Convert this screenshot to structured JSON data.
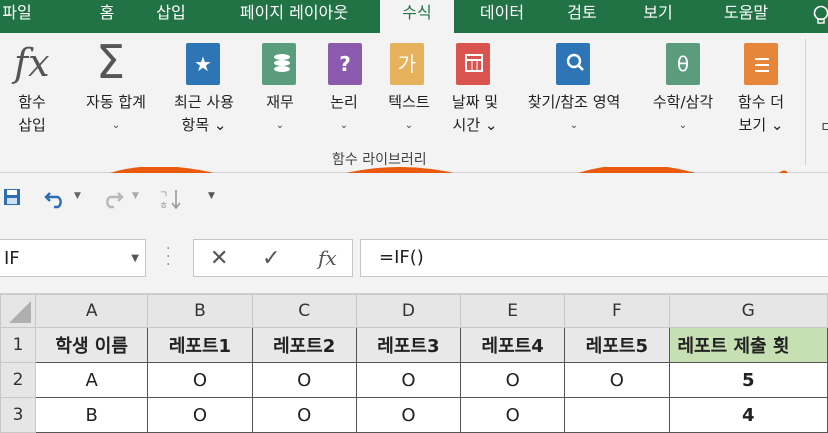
{
  "tabs": [
    {
      "label": "파일",
      "active": false
    },
    {
      "label": "홈",
      "active": false
    },
    {
      "label": "삽입",
      "active": false
    },
    {
      "label": "페이지 레이아웃",
      "active": false
    },
    {
      "label": "수식",
      "active": true
    },
    {
      "label": "데이터",
      "active": false
    },
    {
      "label": "검토",
      "active": false
    },
    {
      "label": "보기",
      "active": false
    },
    {
      "label": "도움말",
      "active": false
    }
  ],
  "ribbon": {
    "insert_function": {
      "line1": "함수",
      "line2": "삽입",
      "icon": "fx-icon"
    },
    "autosum": {
      "line1": "자동 합계",
      "line2": "⌄",
      "icon": "sigma-icon"
    },
    "recent": {
      "line1": "최근 사용",
      "line2": "항목 ⌄",
      "icon": "star-book-icon",
      "color": "#2e75b6"
    },
    "financial": {
      "line1": "재무",
      "line2": "⌄",
      "icon": "coins-book-icon",
      "color": "#5b9c7c"
    },
    "logical": {
      "line1": "논리",
      "line2": "⌄",
      "icon": "question-book-icon",
      "color": "#8c5bb0"
    },
    "text": {
      "line1": "텍스트",
      "line2": "⌄",
      "icon": "text-book-icon",
      "icon_char": "가",
      "color": "#e6b25b"
    },
    "datetime": {
      "line1": "날짜 및",
      "line2": "시간 ⌄",
      "icon": "calendar-book-icon",
      "color": "#d9534f"
    },
    "lookup": {
      "line1": "찾기/참조 영역",
      "line2": "⌄",
      "icon": "magnifier-book-icon",
      "color": "#2e75b6"
    },
    "math": {
      "line1": "수학/삼각",
      "line2": "⌄",
      "icon": "theta-book-icon",
      "icon_char": "θ",
      "color": "#5b9c7c"
    },
    "more": {
      "line1": "함수 더",
      "line2": "보기 ⌄",
      "icon": "more-book-icon",
      "color": "#e6863b"
    },
    "group_label": "함수 라이브러리",
    "cut_char": "ㅁ"
  },
  "formula_bar": {
    "name_box": "IF",
    "cancel": "✕",
    "enter": "✓",
    "fx": "fx",
    "formula": "=IF()"
  },
  "sheet": {
    "columns": [
      "A",
      "B",
      "C",
      "D",
      "E",
      "F",
      "G"
    ],
    "rows": [
      {
        "num": "1",
        "cells": [
          "학생 이름",
          "레포트1",
          "레포트2",
          "레포트3",
          "레포트4",
          "레포트5",
          "레포트 제출 횟"
        ]
      },
      {
        "num": "2",
        "cells": [
          "A",
          "O",
          "O",
          "O",
          "O",
          "O",
          "5"
        ]
      },
      {
        "num": "3",
        "cells": [
          "B",
          "O",
          "O",
          "O",
          "O",
          "",
          "4"
        ]
      }
    ]
  },
  "colors": {
    "excel_green": "#217346",
    "header_green": "#c6e0b4",
    "annotation_orange": "#ea5a0c"
  }
}
